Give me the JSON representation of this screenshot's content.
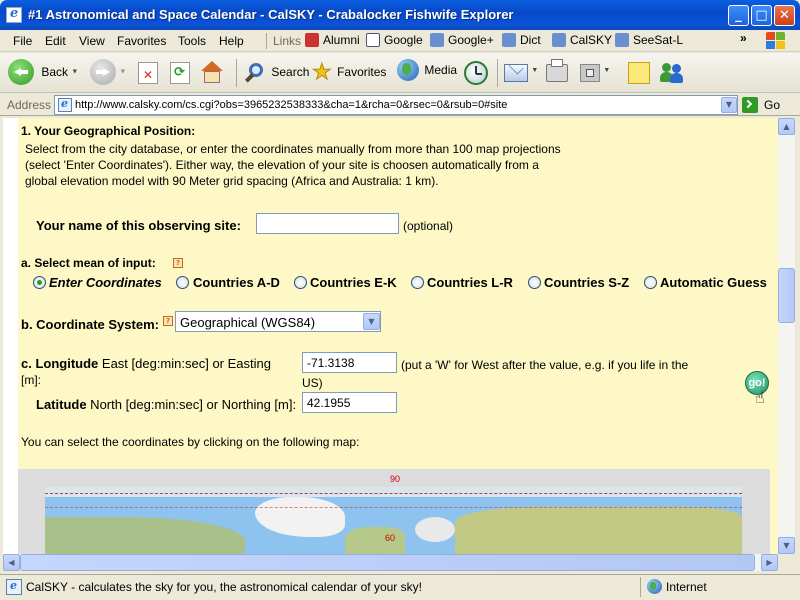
{
  "window": {
    "title": "#1 Astronomical and Space Calendar - CalSKY - Crabalocker Fishwife Explorer",
    "minimize": "_",
    "maximize": "□",
    "close": "✕"
  },
  "menubar": {
    "items": [
      "File",
      "Edit",
      "View",
      "Favorites",
      "Tools",
      "Help"
    ],
    "links_label": "Links",
    "links": [
      "Alumni",
      "Google",
      "Google+",
      "Dict",
      "CalSKY",
      "SeeSat-L"
    ],
    "more": "»"
  },
  "toolbar": {
    "back": "Back",
    "search": "Search",
    "favorites": "Favorites",
    "media": "Media"
  },
  "addressbar": {
    "label": "Address",
    "url": "http://www.calsky.com/cs.cgi?obs=3965232538333&cha=1&rcha=0&rsec=0&rsub=0#site",
    "go": "Go"
  },
  "page": {
    "section_title": "1. Your Geographical Position:",
    "intro": [
      "Select from the city database, or enter the coordinates manually from more than 100 map projections",
      "(select 'Enter Coordinates'). Either way, the elevation of your site is choosen automatically from a",
      "global elevation model with 90 Meter grid spacing (Africa and Australia: 1 km)."
    ],
    "site_name_label": "Your name of this observing site:",
    "site_name_value": "",
    "optional": "(optional)",
    "mean_of_input_label": "a. Select mean of input:",
    "input_options": [
      {
        "label": "Enter Coordinates",
        "selected": true
      },
      {
        "label": "Countries A-D",
        "selected": false
      },
      {
        "label": "Countries E-K",
        "selected": false
      },
      {
        "label": "Countries L-R",
        "selected": false
      },
      {
        "label": "Countries S-Z",
        "selected": false
      },
      {
        "label": "Automatic Guess",
        "selected": false
      }
    ],
    "coord_system_label": "b. Coordinate System:",
    "coord_system_value": "Geographical (WGS84)",
    "longitude_label_bold": "c. Longitude",
    "longitude_label_rest": " East [deg:min:sec] or Easting",
    "longitude_label_unit": "[m]:",
    "longitude_value": "-71.3138",
    "longitude_hint_1": "(put a 'W' for West after the value, e.g. if you life in the",
    "longitude_hint_2": "US)",
    "latitude_label_bold": "Latitude",
    "latitude_label_rest": " North [deg:min:sec] or Northing [m]:",
    "latitude_value": "42.1955",
    "go_button": "go!",
    "map_hint": "You can select the coordinates by clicking on the following map:",
    "map_labels": [
      "90",
      "60"
    ]
  },
  "statusbar": {
    "text": "CalSKY - calculates the sky for you, the astronomical calendar of your sky!",
    "zone": "Internet"
  },
  "colors": {
    "panel_bg": "#fdf8c6",
    "titlebar": "#0a52d8",
    "radio_dot": "#21a121",
    "go_button": "#2fa37a"
  }
}
